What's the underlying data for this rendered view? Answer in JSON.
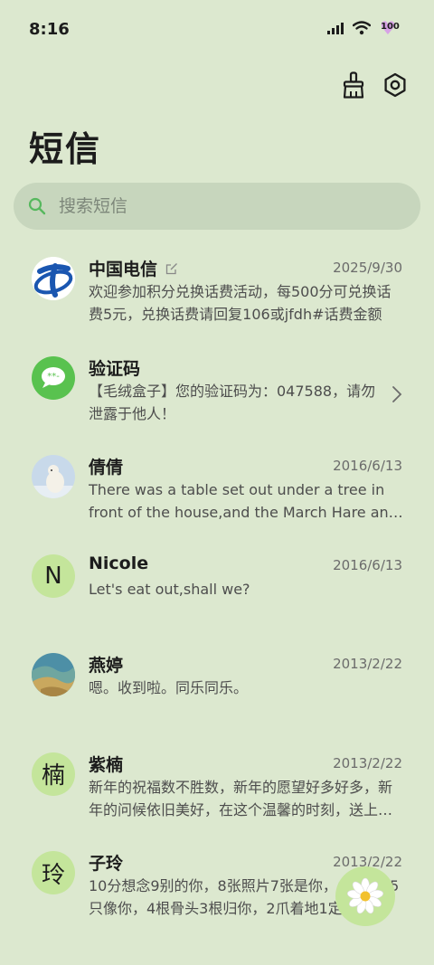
{
  "status": {
    "time": "8:16",
    "battery": "100"
  },
  "header": {
    "title": "短信",
    "clean_icon": "broom-icon",
    "settings_icon": "settings-icon"
  },
  "search": {
    "placeholder": "搜索短信"
  },
  "messages": [
    {
      "name": "中国电信",
      "date": "2025/9/30",
      "preview": "欢迎参加积分兑换话费活动，每500分可兑换话费5元，兑换话费请回复106或jfdh#话费金额",
      "avatar": "china-telecom-logo"
    },
    {
      "name": "验证码",
      "date": "",
      "preview": "【毛绒盒子】您的验证码为：047588，请勿泄露于他人！",
      "avatar": "message-icon"
    },
    {
      "name": "倩倩",
      "date": "2016/6/13",
      "preview": "There was a table set out under a tree in front of the house,and the March Hare and the Hatter",
      "avatar": "polar-bear-photo"
    },
    {
      "name": "Nicole",
      "date": "2016/6/13",
      "preview": "Let's eat out,shall we?",
      "avatar_letter": "N"
    },
    {
      "name": "燕婷",
      "date": "2013/2/22",
      "preview": "嗯。收到啦。同乐同乐。",
      "avatar": "landscape-photo"
    },
    {
      "name": "紫楠",
      "date": "2013/2/22",
      "preview": "新年的祝福数不胜数，新年的愿望好多好多，新年的问候依旧美好，在这个温馨的时刻，送上祝福",
      "avatar_letter": "楠"
    },
    {
      "name": "子玲",
      "date": "2013/2/22",
      "preview": "10分想念9别的你，8张照片7张是你，6只小狗5只像你，4根骨头3根归你，2爪着地1定是你",
      "avatar_letter": "玲"
    }
  ],
  "fab": {
    "icon": "daisy-icon"
  }
}
